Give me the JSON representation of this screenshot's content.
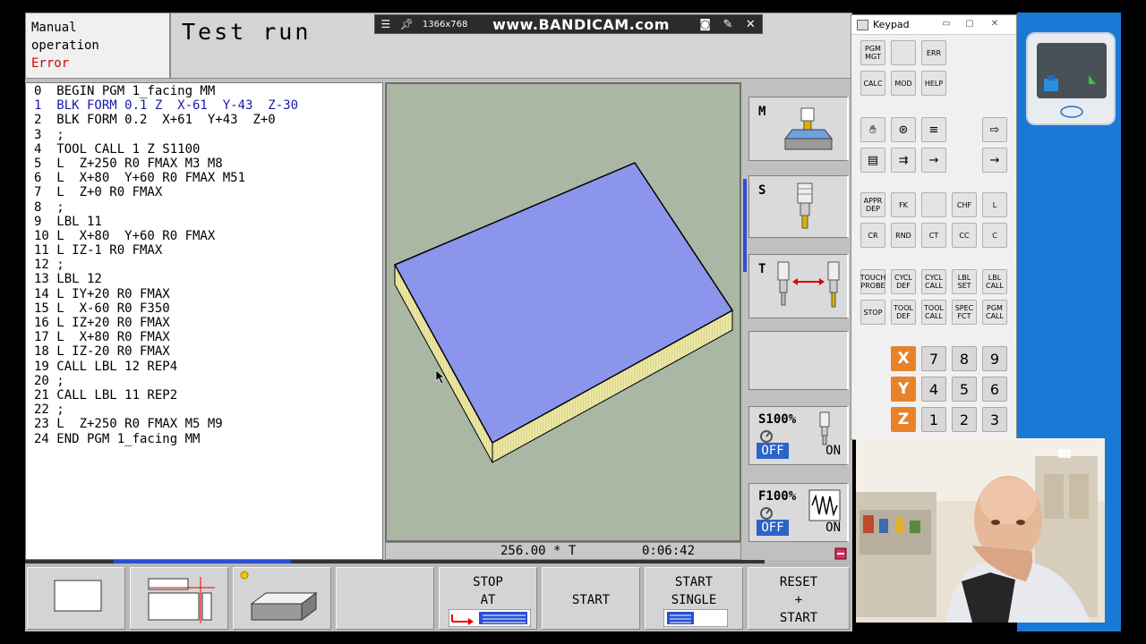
{
  "mode": {
    "line1": "Manual",
    "line2": "operation",
    "status": "Error"
  },
  "title": "Test run",
  "recorder": {
    "resolution": "1366x768",
    "brand": "www.BANDICAM.com"
  },
  "program": [
    "0  BEGIN PGM 1_facing MM",
    "1  BLK FORM 0.1 Z  X-61  Y-43  Z-30",
    "2  BLK FORM 0.2  X+61  Y+43  Z+0",
    "3  ;",
    "4  TOOL CALL 1 Z S1100",
    "5  L  Z+250 R0 FMAX M3 M8",
    "6  L  X+80  Y+60 R0 FMAX M51",
    "7  L  Z+0 R0 FMAX",
    "8  ;",
    "9  LBL 11",
    "10 L  X+80  Y+60 R0 FMAX",
    "11 L IZ-1 R0 FMAX",
    "12 ;",
    "13 LBL 12",
    "14 L IY+20 R0 FMAX",
    "15 L  X-60 R0 F350",
    "16 L IZ+20 R0 FMAX",
    "17 L  X+80 R0 FMAX",
    "18 L IZ-20 R0 FMAX",
    "19 CALL LBL 12 REP4",
    "20 ;",
    "21 CALL LBL 11 REP2",
    "22 ;",
    "23 L  Z+250 R0 FMAX M5 M9",
    "24 END PGM 1_facing MM"
  ],
  "active_line_index": 1,
  "graphic_status": {
    "position": "256.00 * T",
    "time": "0:06:42"
  },
  "panels": {
    "m": "M",
    "s": "S",
    "t": "T",
    "spindle_override": {
      "label": "S100%",
      "off": "OFF",
      "on": "ON"
    },
    "feed_override": {
      "label": "F100%",
      "off": "OFF",
      "on": "ON"
    }
  },
  "softkeys": {
    "stop_at": "STOP\nAT",
    "start": "START",
    "start_single": "START\nSINGLE",
    "reset_start": "RESET\n+\nSTART",
    "progress_start": 0.12,
    "progress_end": 0.36
  },
  "keypad": {
    "title": "Keypad",
    "row1": [
      "PGM\nMGT",
      "",
      "ERR"
    ],
    "row2": [
      "CALC",
      "MOD",
      "HELP"
    ],
    "row3": [
      "APPR\nDEP",
      "FK",
      "",
      "CHF",
      "L"
    ],
    "row4": [
      "CR",
      "RND",
      "CT",
      "CC",
      "C"
    ],
    "row5": [
      "TOUCH\nPROBE",
      "CYCL\nDEF",
      "CYCL\nCALL",
      "LBL\nSET",
      "LBL\nCALL"
    ],
    "row6": [
      "STOP",
      "TOOL\nDEF",
      "TOOL\nCALL",
      "SPEC\nFCT",
      "PGM\nCALL"
    ],
    "axes": [
      "X",
      "Y",
      "Z"
    ],
    "numbers": [
      [
        "7",
        "8",
        "9"
      ],
      [
        "4",
        "5",
        "6"
      ],
      [
        "1",
        "2",
        "3"
      ]
    ]
  },
  "colors": {
    "active_line": "#1a1aa8",
    "error": "#d00000",
    "workpiece_top": "#8c95ec",
    "workpiece_side": "#ece7a0",
    "axis_key": "#e8822a",
    "switch_off": "#2b63c9",
    "desktop": "#1979d6"
  }
}
